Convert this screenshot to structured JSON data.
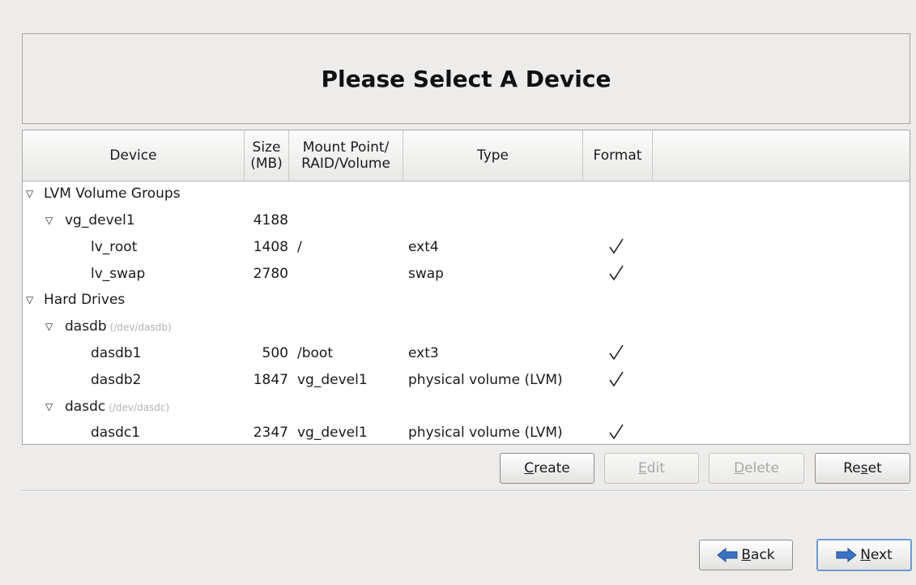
{
  "title": "Please Select A Device",
  "columns": {
    "device": "Device",
    "size_line1": "Size",
    "size_line2": "(MB)",
    "mount_line1": "Mount Point/",
    "mount_line2": "RAID/Volume",
    "type": "Type",
    "format": "Format"
  },
  "rows": [
    {
      "device": "LVM Volume Groups",
      "level": 0,
      "expanded": true,
      "size": "",
      "mount": "",
      "type": "",
      "format": false
    },
    {
      "device": "vg_devel1",
      "level": 1,
      "expanded": true,
      "size": "4188",
      "mount": "",
      "type": "",
      "format": false
    },
    {
      "device": "lv_root",
      "level": 2,
      "size": "1408",
      "mount": "/",
      "type": "ext4",
      "format": true
    },
    {
      "device": "lv_swap",
      "level": 2,
      "size": "2780",
      "mount": "",
      "type": "swap",
      "format": true
    },
    {
      "device": "Hard Drives",
      "level": 0,
      "expanded": true,
      "size": "",
      "mount": "",
      "type": "",
      "format": false
    },
    {
      "device": "dasdb",
      "path": "(/dev/dasdb)",
      "level": 1,
      "expanded": true,
      "size": "",
      "mount": "",
      "type": "",
      "format": false
    },
    {
      "device": "dasdb1",
      "level": 2,
      "size": "500",
      "mount": "/boot",
      "type": "ext3",
      "format": true
    },
    {
      "device": "dasdb2",
      "level": 2,
      "size": "1847",
      "mount": "vg_devel1",
      "type": "physical volume (LVM)",
      "format": true
    },
    {
      "device": "dasdc",
      "path": "(/dev/dasdc)",
      "level": 1,
      "expanded": true,
      "size": "",
      "mount": "",
      "type": "",
      "format": false
    },
    {
      "device": "dasdc1",
      "level": 2,
      "size": "2347",
      "mount": "vg_devel1",
      "type": "physical volume (LVM)",
      "format": true
    }
  ],
  "buttons": {
    "create_rest": "reate",
    "create_ul": "C",
    "edit_rest": "dit",
    "edit_ul": "E",
    "delete_rest": "elete",
    "delete_ul": "D",
    "reset_pre": "Re",
    "reset_ul": "s",
    "reset_rest": "et",
    "back_ul": "B",
    "back_rest": "ack",
    "next_ul": "N",
    "next_rest": "ext"
  },
  "colors": {
    "background": "#edeceb",
    "arrow_blue": "#3b73c4",
    "focus_border": "#6f9ad2"
  },
  "icons": [
    "triangle-expanded-icon",
    "checkmark-icon",
    "back-arrow-icon",
    "next-arrow-icon"
  ]
}
